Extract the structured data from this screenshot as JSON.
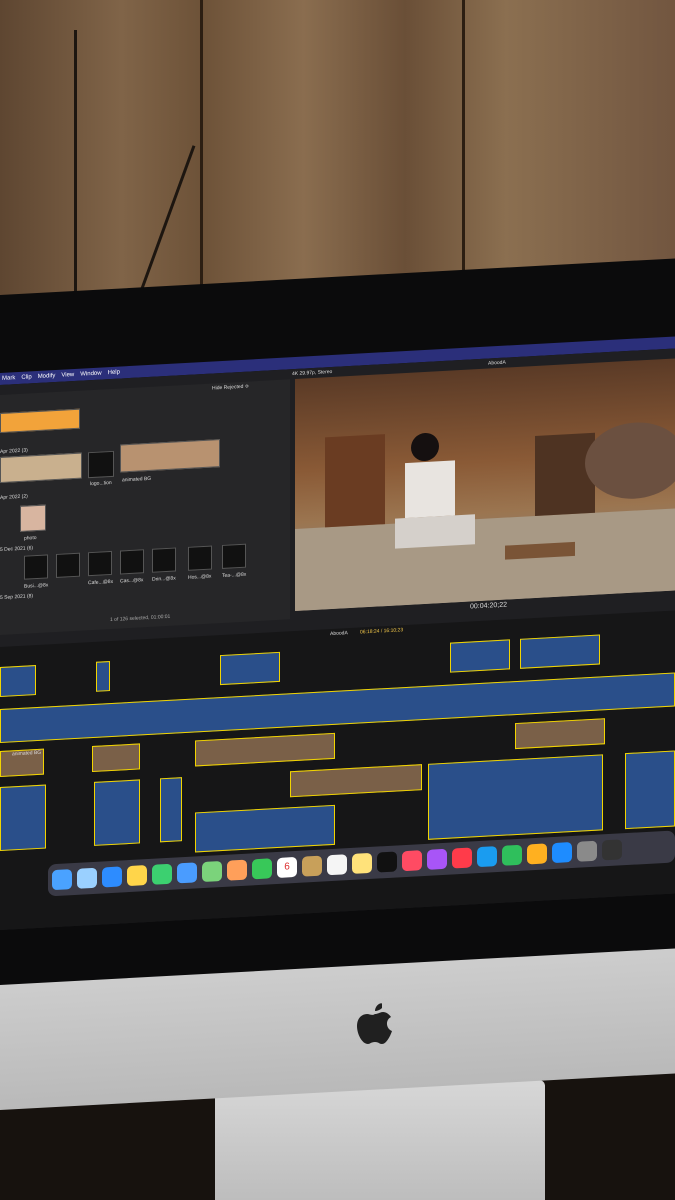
{
  "menu": [
    "Mark",
    "Clip",
    "Modify",
    "View",
    "Window",
    "Help"
  ],
  "browser": {
    "filter": "Hide Rejected ≎",
    "group1": "Apr 2022 (3)",
    "group2": "Apr 2022 (2)",
    "group3": "5 Dec 2021 (6)",
    "group4": "5 Sep 2021 (8)",
    "thumb_logo": "logo...tion",
    "thumb_bg": "animated BG",
    "thumb_photo": "photo",
    "icons": [
      "Busi...@8x",
      "Cafe...@8x",
      "Cas...@8x",
      "Drin...@8x",
      "Hos...@8x",
      "Tea-...@8x"
    ],
    "status": "1 of 126 selected, 01:00:01"
  },
  "viewer": {
    "format": "4K 29.97p, Stereo",
    "project": "AboodA",
    "timecode": "00:04:20;22"
  },
  "timeline": {
    "project": "AboodA",
    "position": "06:18:24 / 16:10;23",
    "clip_label": "animated BG"
  },
  "dock_date": "6",
  "colors": {
    "menubar": "#2b2f7a",
    "clip_border": "#f1d400",
    "clip_fill": "#2a4f8a"
  }
}
